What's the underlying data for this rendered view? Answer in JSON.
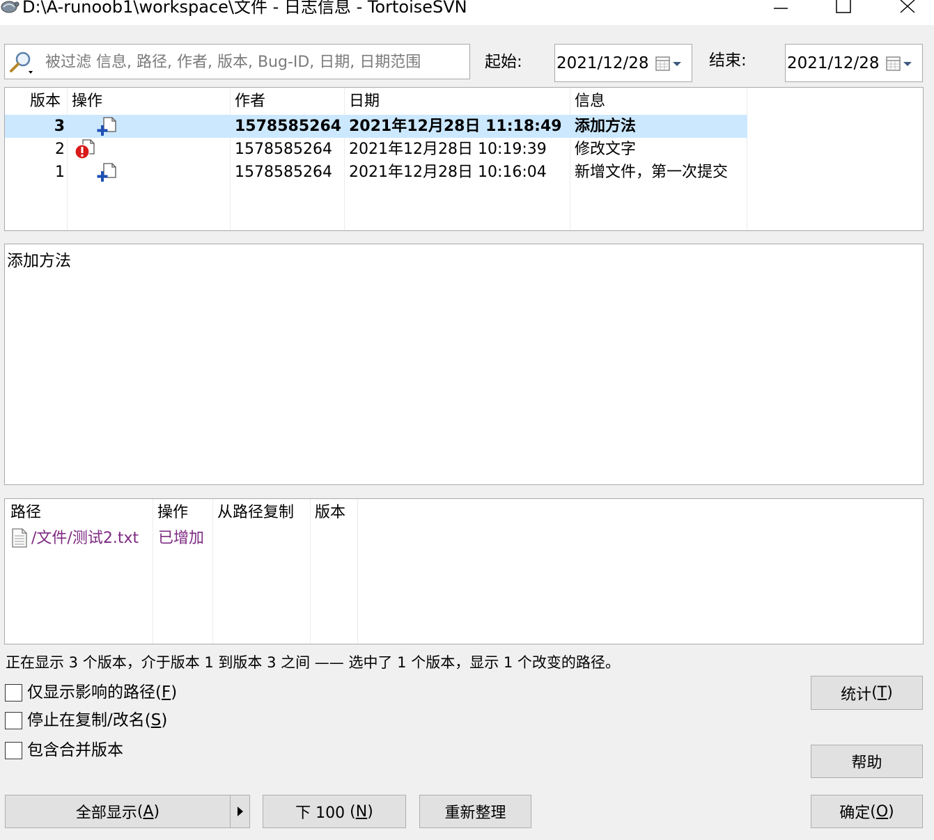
{
  "window": {
    "title": "D:\\A-runoob1\\workspace\\文件 - 日志信息 - TortoiseSVN"
  },
  "filter": {
    "placeholder": "被过滤 信息, 路径, 作者, 版本, Bug-ID, 日期, 日期范围",
    "start_label": "起始:",
    "start_date": "2021/12/28",
    "end_label": "结束:",
    "end_date": "2021/12/28"
  },
  "log_table": {
    "headers": [
      "版本",
      "操作",
      "作者",
      "日期",
      "信息"
    ],
    "rows": [
      {
        "revision": "3",
        "action_icon": "file-add-icon",
        "author": "1578585264",
        "date": "2021年12月28日 11:18:49",
        "message": "添加方法",
        "selected": true
      },
      {
        "revision": "2",
        "action_icon": "file-modified-icon",
        "author": "1578585264",
        "date": "2021年12月28日 10:19:39",
        "message": "修改文字",
        "selected": false
      },
      {
        "revision": "1",
        "action_icon": "file-add-icon",
        "author": "1578585264",
        "date": "2021年12月28日 10:16:04",
        "message": "新增文件，第一次提交",
        "selected": false
      }
    ]
  },
  "message_pane": {
    "text": "添加方法"
  },
  "paths_table": {
    "headers": [
      "路径",
      "操作",
      "从路径复制",
      "版本"
    ],
    "rows": [
      {
        "path": "/文件/测试2.txt",
        "action": "已增加",
        "copy_from": "",
        "revision": ""
      }
    ]
  },
  "status": {
    "text": "正在显示 3 个版本，介于版本 1 到版本 3 之间 —— 选中了 1 个版本，显示 1 个改变的路径。"
  },
  "options": {
    "affected_paths_label": "仅显示影响的路径",
    "affected_paths_key": "F",
    "stop_on_copy_label": "停止在复制/改名",
    "stop_on_copy_key": "S",
    "include_merged_label": "包含合并版本"
  },
  "buttons": {
    "statistics_label": "统计",
    "statistics_key": "T",
    "help_label": "帮助",
    "show_all_label": "全部显示",
    "show_all_key": "A",
    "next100_label": "下 100 ",
    "next100_key": "N",
    "refresh_label": "重新整理",
    "ok_label": "确定",
    "ok_key": "O"
  },
  "colors": {
    "selection": "#cce8ff",
    "added_text": "#7d2a82",
    "add_icon": "#1e4fb4",
    "error_icon": "#d91a1a"
  }
}
